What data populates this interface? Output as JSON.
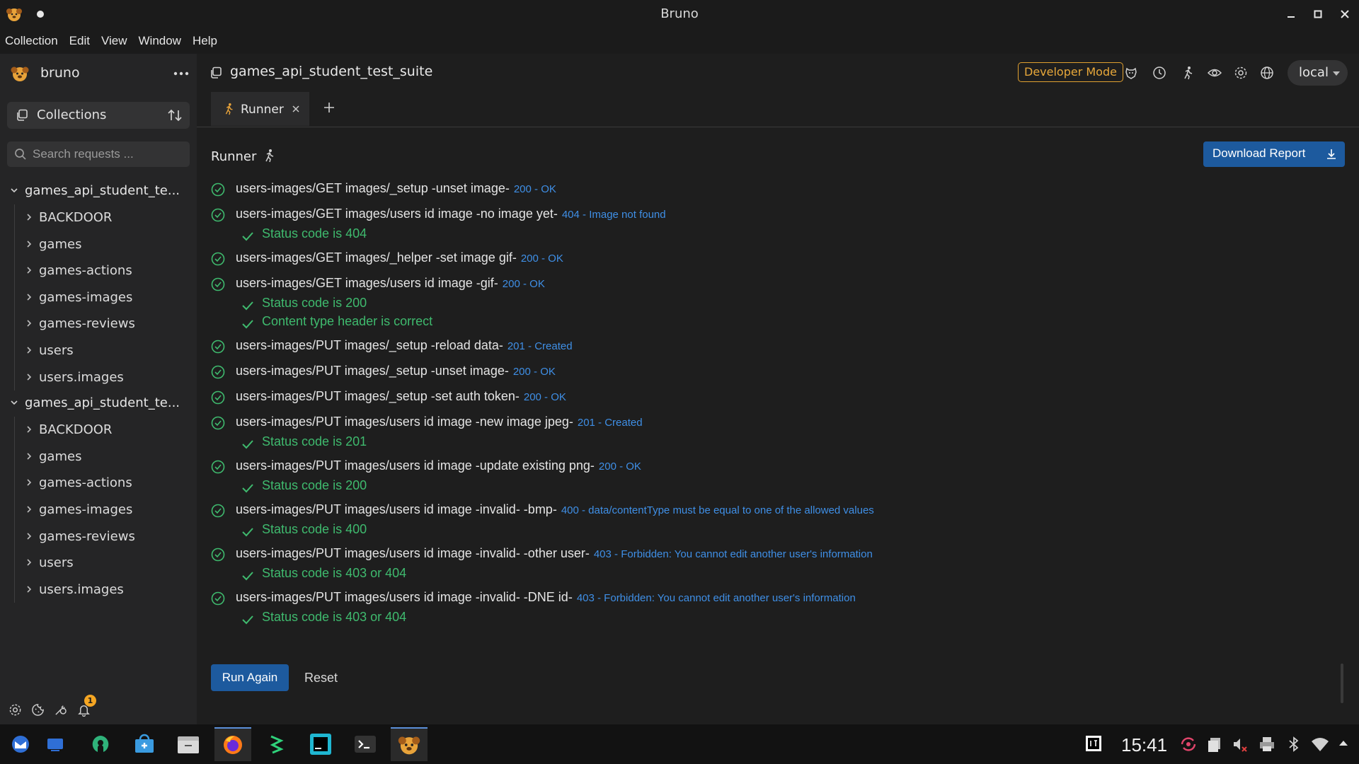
{
  "window": {
    "title": "Bruno"
  },
  "menu": [
    "Collection",
    "Edit",
    "View",
    "Window",
    "Help"
  ],
  "sidebar": {
    "app_name": "bruno",
    "collections_label": "Collections",
    "search_placeholder": "Search requests ...",
    "collections": [
      {
        "name": "games_api_student_te...",
        "items": [
          "BACKDOOR",
          "games",
          "games-actions",
          "games-images",
          "games-reviews",
          "users",
          "users.images"
        ]
      },
      {
        "name": "games_api_student_te...",
        "items": [
          "BACKDOOR",
          "games",
          "games-actions",
          "games-images",
          "games-reviews",
          "users",
          "users.images"
        ]
      }
    ],
    "notification_count": "1"
  },
  "header": {
    "collection_name": "games_api_student_test_suite",
    "developer_mode": "Developer Mode",
    "environment": "local"
  },
  "tabs": [
    {
      "label": "Runner"
    }
  ],
  "runner": {
    "title": "Runner",
    "download_label": "Download Report",
    "run_again_label": "Run Again",
    "reset_label": "Reset",
    "results": [
      {
        "name": "users-images/GET images/_setup -unset image-",
        "status": "200 - OK",
        "assertions": []
      },
      {
        "name": "users-images/GET images/users id image -no image yet-",
        "status": "404 - Image not found",
        "assertions": [
          "Status code is 404"
        ]
      },
      {
        "name": "users-images/GET images/_helper -set image gif-",
        "status": "200 - OK",
        "assertions": []
      },
      {
        "name": "users-images/GET images/users id image -gif-",
        "status": "200 - OK",
        "assertions": [
          "Status code is 200",
          "Content type header is correct"
        ]
      },
      {
        "name": "users-images/PUT images/_setup -reload data-",
        "status": "201 - Created",
        "assertions": []
      },
      {
        "name": "users-images/PUT images/_setup -unset image-",
        "status": "200 - OK",
        "assertions": []
      },
      {
        "name": "users-images/PUT images/_setup -set auth token-",
        "status": "200 - OK",
        "assertions": []
      },
      {
        "name": "users-images/PUT images/users id image -new image jpeg-",
        "status": "201 - Created",
        "assertions": [
          "Status code is 201"
        ]
      },
      {
        "name": "users-images/PUT images/users id image -update existing png-",
        "status": "200 - OK",
        "assertions": [
          "Status code is 200"
        ]
      },
      {
        "name": "users-images/PUT images/users id image -invalid- -bmp-",
        "status": "400 - data/contentType must be equal to one of the allowed values",
        "assertions": [
          "Status code is 400"
        ]
      },
      {
        "name": "users-images/PUT images/users id image -invalid- -other user-",
        "status": "403 - Forbidden: You cannot edit another user's information",
        "assertions": [
          "Status code is 403 or 404"
        ]
      },
      {
        "name": "users-images/PUT images/users id image -invalid- -DNE id-",
        "status": "403 - Forbidden: You cannot edit another user's information",
        "assertions": [
          "Status code is 403 or 404"
        ]
      }
    ]
  },
  "taskbar": {
    "clock": "15:41",
    "apps": [
      "thunderbird-icon",
      "desktop-icon",
      "github-desktop-icon",
      "store-icon",
      "files-icon",
      "firefox-icon",
      "terminal-app-icon",
      "webstorm-icon",
      "konsole-icon",
      "bruno-icon"
    ]
  },
  "colors": {
    "accent": "#1d5a9e",
    "status_blue": "#3f8fe6",
    "pass_green": "#3fba6e",
    "dev_mode_orange": "#e8a83a"
  }
}
